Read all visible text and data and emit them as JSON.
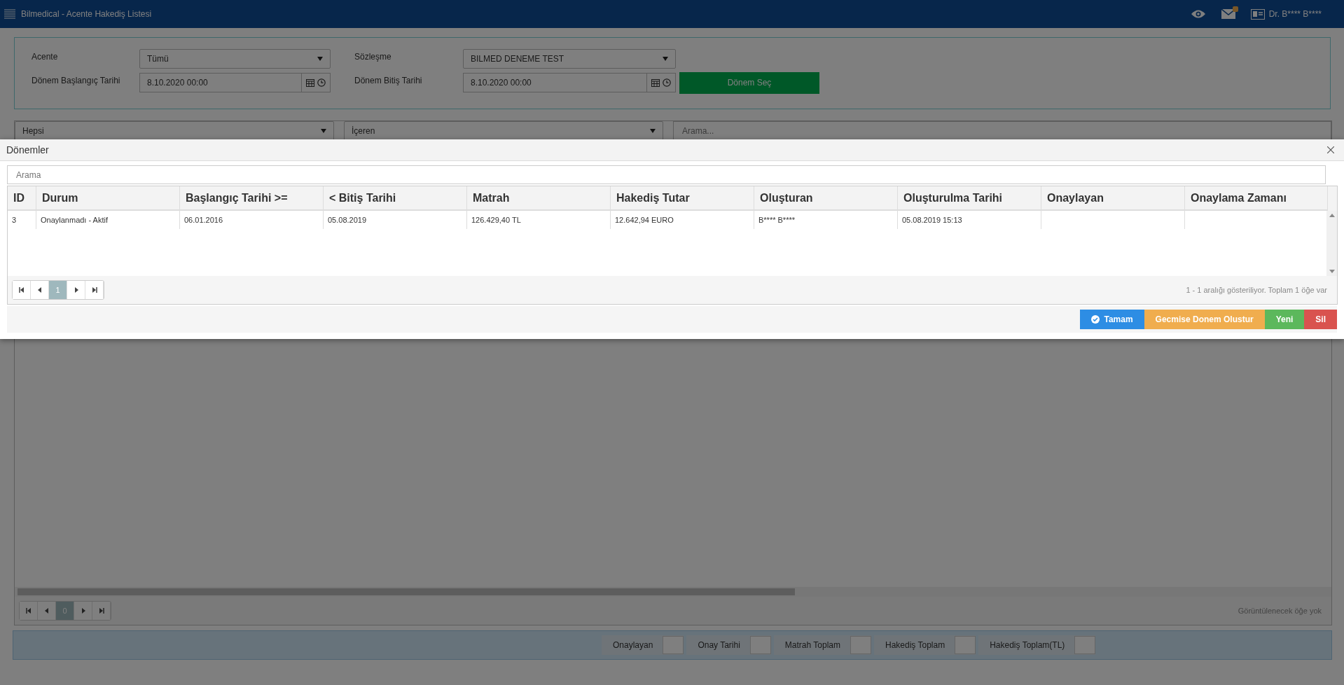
{
  "topbar": {
    "title": "Bilmedical - Acente Hakediş Listesi",
    "user": "Dr. B**** B****"
  },
  "filters": {
    "acente": {
      "label": "Acente",
      "value": "Tümü"
    },
    "sozlesme": {
      "label": "Sözleşme",
      "value": "BILMED DENEME TEST"
    },
    "baslangic": {
      "label": "Dönem Başlangıç Tarihi",
      "value": "8.10.2020 00:00"
    },
    "bitis": {
      "label": "Dönem Bitiş Tarihi",
      "value": "8.10.2020 00:00"
    },
    "button": "Dönem Seç"
  },
  "grid": {
    "selects": [
      "Hepsi",
      "İçeren"
    ],
    "search_placeholder": "Arama...",
    "pager": {
      "pages": [
        {
          "label": "0",
          "selected": true
        }
      ],
      "info": "Görüntülenecek öğe yok"
    }
  },
  "summary": [
    "Onaylayan",
    "Onay Tarihi",
    "Matrah Toplam",
    "Hakediş Toplam",
    "Hakediş Toplam(TL)"
  ],
  "modal": {
    "title": "Dönemler",
    "search_placeholder": "Arama",
    "columns": [
      "ID",
      "Durum",
      "Başlangıç Tarihi >=",
      "< Bitiş Tarihi",
      "Matrah",
      "Hakediş Tutar",
      "Oluşturan",
      "Oluşturulma Tarihi",
      "Onaylayan",
      "Onaylama Zamanı"
    ],
    "rows": [
      {
        "cells": [
          "3",
          "Onaylanmadı - Aktif",
          "06.01.2016",
          "05.08.2019",
          "126.429,40 TL",
          "12.642,94 EURO",
          "B**** B****",
          "05.08.2019 15:13",
          "",
          ""
        ]
      }
    ],
    "pager": {
      "pages": [
        {
          "label": "1",
          "selected": true
        }
      ],
      "info": "1 - 1 aralığı gösteriliyor. Toplam 1 öğe var"
    },
    "buttons": [
      {
        "label": "Tamam",
        "kind": "primary"
      },
      {
        "label": "Gecmise Donem Olustur",
        "kind": "warning"
      },
      {
        "label": "Yeni",
        "kind": "success"
      },
      {
        "label": "Sil",
        "kind": "danger"
      }
    ]
  }
}
